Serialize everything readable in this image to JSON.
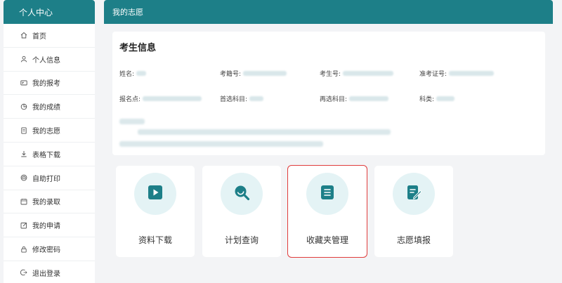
{
  "sidebar": {
    "title": "个人中心",
    "items": [
      {
        "label": "首页",
        "icon": "home-icon"
      },
      {
        "label": "个人信息",
        "icon": "user-icon"
      },
      {
        "label": "我的报考",
        "icon": "card-icon"
      },
      {
        "label": "我的成绩",
        "icon": "pie-chart-icon"
      },
      {
        "label": "我的志愿",
        "icon": "document-icon"
      },
      {
        "label": "表格下载",
        "icon": "download-icon"
      },
      {
        "label": "自助打印",
        "icon": "printer-icon"
      },
      {
        "label": "我的录取",
        "icon": "calendar-icon"
      },
      {
        "label": "我的申请",
        "icon": "edit-icon"
      },
      {
        "label": "修改密码",
        "icon": "lock-icon"
      },
      {
        "label": "退出登录",
        "icon": "logout-icon"
      }
    ]
  },
  "main": {
    "title": "我的志愿",
    "info": {
      "title": "考生信息",
      "fields": {
        "name": "姓名:",
        "reg_no": "考籍号:",
        "exam_no": "考生号:",
        "ticket_no": "准考证号:",
        "site": "报名点:",
        "first_subject": "首选科目:",
        "second_subject": "再选科目:",
        "category": "科类:"
      }
    },
    "tiles": [
      {
        "label": "资料下载",
        "icon": "play-icon"
      },
      {
        "label": "计划查询",
        "icon": "search-icon"
      },
      {
        "label": "收藏夹管理",
        "icon": "list-icon"
      },
      {
        "label": "志愿填报",
        "icon": "edit-form-icon"
      }
    ]
  },
  "colors": {
    "accent": "#1d7f88",
    "tile_circle": "#e4f3f5",
    "highlight_border": "#e03c3c"
  }
}
